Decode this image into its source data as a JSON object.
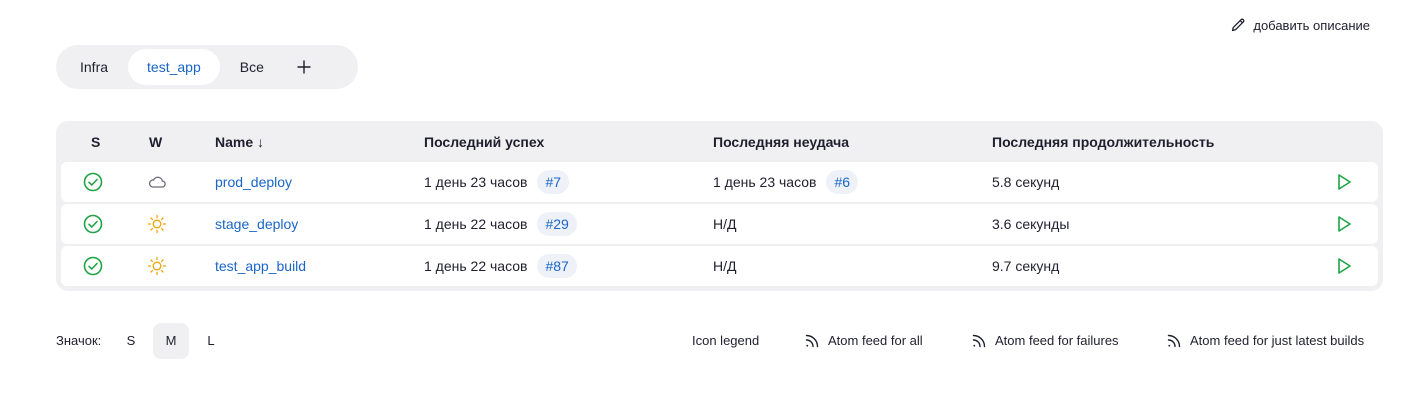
{
  "header": {
    "add_description": "добавить описание"
  },
  "tabs": [
    {
      "label": "Infra",
      "active": false
    },
    {
      "label": "test_app",
      "active": true
    },
    {
      "label": "Все",
      "active": false
    }
  ],
  "table": {
    "columns": {
      "s": "S",
      "w": "W",
      "name": "Name ↓",
      "last_success": "Последний успех",
      "last_failure": "Последняя неудача",
      "last_duration": "Последняя продолжительность"
    },
    "rows": [
      {
        "status": "success",
        "weather": "cloudy-icon",
        "name": "prod_deploy",
        "last_success": "1 день 23 часов",
        "success_build": "#7",
        "last_failure": "1 день 23 часов",
        "failure_build": "#6",
        "duration": "5.8 секунд"
      },
      {
        "status": "success",
        "weather": "sunny-icon",
        "name": "stage_deploy",
        "last_success": "1 день 22 часов",
        "success_build": "#29",
        "last_failure": "Н/Д",
        "failure_build": "",
        "duration": "3.6 секунды"
      },
      {
        "status": "success",
        "weather": "sunny-icon",
        "name": "test_app_build",
        "last_success": "1 день 22 часов",
        "success_build": "#87",
        "last_failure": "Н/Д",
        "failure_build": "",
        "duration": "9.7 секунд"
      }
    ]
  },
  "footer": {
    "icon_label": "Значок:",
    "sizes": [
      {
        "label": "S",
        "active": false
      },
      {
        "label": "M",
        "active": true
      },
      {
        "label": "L",
        "active": false
      }
    ],
    "icon_legend": "Icon legend",
    "feed_all": "Atom feed for all",
    "feed_failures": "Atom feed for failures",
    "feed_latest": "Atom feed for just latest builds"
  },
  "colors": {
    "accent": "#1966c7",
    "success": "#1ea446",
    "sunny": "#f0a500",
    "panel": "#f0f0f3"
  }
}
